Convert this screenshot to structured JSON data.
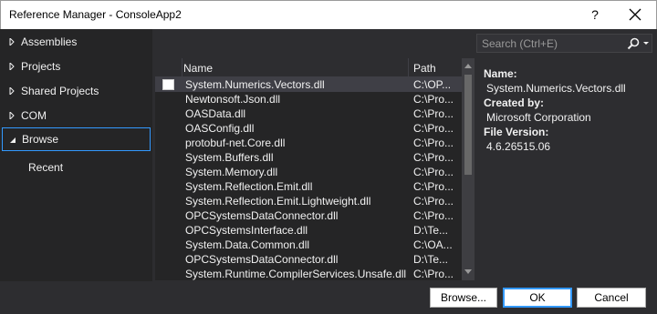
{
  "window": {
    "title": "Reference Manager - ConsoleApp2",
    "help_label": "?"
  },
  "sidebar": {
    "items": [
      {
        "label": "Assemblies",
        "expanded": false
      },
      {
        "label": "Projects",
        "expanded": false
      },
      {
        "label": "Shared Projects",
        "expanded": false
      },
      {
        "label": "COM",
        "expanded": false
      },
      {
        "label": "Browse",
        "expanded": true,
        "selected": true
      }
    ],
    "recent_label": "Recent"
  },
  "list": {
    "columns": {
      "name": "Name",
      "path": "Path"
    },
    "rows": [
      {
        "name": "System.Numerics.Vectors.dll",
        "path": "C:\\OP...",
        "checked": false,
        "selected": true
      },
      {
        "name": "Newtonsoft.Json.dll",
        "path": "C:\\Pro..."
      },
      {
        "name": "OASData.dll",
        "path": "C:\\Pro..."
      },
      {
        "name": "OASConfig.dll",
        "path": "C:\\Pro..."
      },
      {
        "name": "protobuf-net.Core.dll",
        "path": "C:\\Pro..."
      },
      {
        "name": "System.Buffers.dll",
        "path": "C:\\Pro..."
      },
      {
        "name": "System.Memory.dll",
        "path": "C:\\Pro..."
      },
      {
        "name": "System.Reflection.Emit.dll",
        "path": "C:\\Pro..."
      },
      {
        "name": "System.Reflection.Emit.Lightweight.dll",
        "path": "C:\\Pro..."
      },
      {
        "name": "OPCSystemsDataConnector.dll",
        "path": "C:\\Pro..."
      },
      {
        "name": "OPCSystemsInterface.dll",
        "path": "D:\\Te..."
      },
      {
        "name": "System.Data.Common.dll",
        "path": "C:\\OA..."
      },
      {
        "name": "OPCSystemsDataConnector.dll",
        "path": "D:\\Te..."
      },
      {
        "name": "System.Runtime.CompilerServices.Unsafe.dll",
        "path": "C:\\Pro..."
      }
    ]
  },
  "search": {
    "placeholder": "Search (Ctrl+E)"
  },
  "details": {
    "name_label": "Name:",
    "name_value": "System.Numerics.Vectors.dll",
    "created_label": "Created by:",
    "created_value": "Microsoft Corporation",
    "version_label": "File Version:",
    "version_value": "4.6.26515.06"
  },
  "buttons": {
    "browse": "Browse...",
    "ok": "OK",
    "cancel": "Cancel"
  },
  "colors": {
    "accent": "#3399ff",
    "background": "#2d2d30",
    "panel": "#252526",
    "text": "#f1f1f1"
  }
}
